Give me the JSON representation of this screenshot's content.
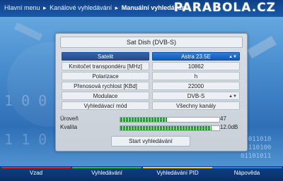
{
  "breadcrumb": {
    "items": [
      "Hlavní menu",
      "Kanálové vyhledávání"
    ],
    "current": "Manuální vyhledávání",
    "separator": "▸"
  },
  "watermark": "PARABOLA.CZ",
  "dialog": {
    "header": "Sat Dish (DVB-S)",
    "rows": [
      {
        "label": "Satelit",
        "value": "Astra 23.5E",
        "selected": true,
        "arrow": "▲▼"
      },
      {
        "label": "Kmitočet transpondéru [MHz]",
        "value": "10862"
      },
      {
        "label": "Polarizace",
        "value": "h"
      },
      {
        "label": "Přenosová rychlost [KBd]",
        "value": "22000"
      },
      {
        "label": "Modulace",
        "value": "DVB-S",
        "arrow": "▲▼"
      },
      {
        "label": "Vyhledávací mód",
        "value": "Všechny kanály"
      }
    ],
    "meters": [
      {
        "label": "Úroveň",
        "value": "47",
        "level": 0.47
      },
      {
        "label": "Kvalita",
        "value": "12.0dB",
        "level": 0.92
      }
    ],
    "start_button": "Start vyhledávání"
  },
  "footer": [
    {
      "label": "Vzad",
      "color": "#d9262b"
    },
    {
      "label": "Vyhledávání",
      "color": "#2db34a"
    },
    {
      "label": "Vyhledávání PID",
      "color": "#e8d21f"
    },
    {
      "label": "Nápověda",
      "color": "#2f7be0"
    }
  ]
}
